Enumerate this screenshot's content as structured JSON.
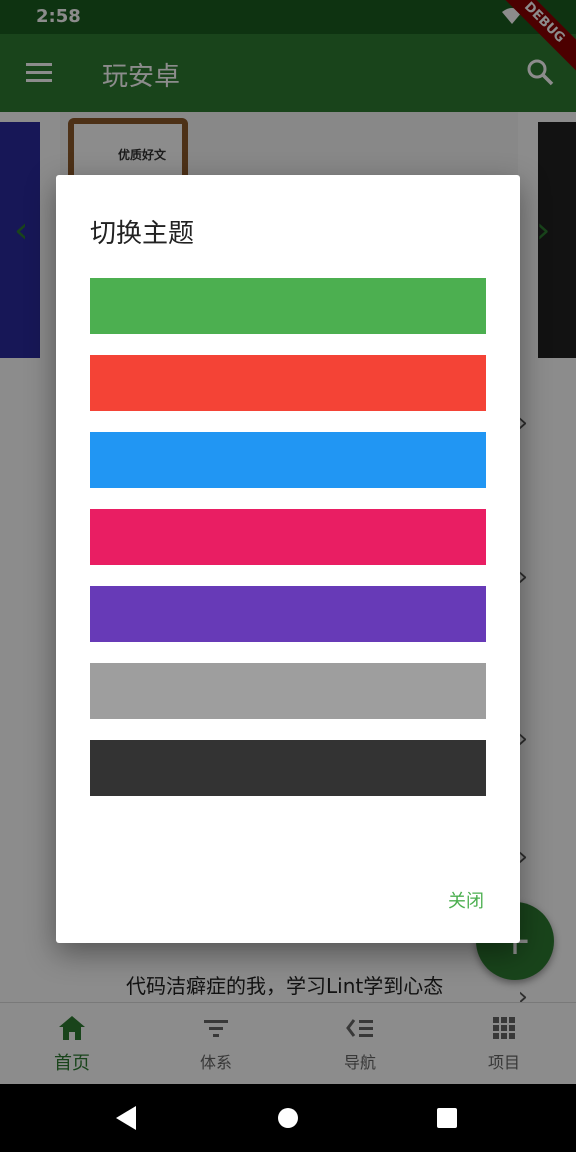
{
  "status_bar": {
    "time": "2:58",
    "debug_label": "DEBUG",
    "icons": [
      "wifi-icon",
      "battery-icon"
    ]
  },
  "app_bar": {
    "title": "玩安卓",
    "icons": [
      "menu-icon",
      "search-icon"
    ],
    "color": "#2e7d32"
  },
  "background_list": {
    "visible_item_text": "代码洁癖症的我，学习Lint学到心态",
    "banner_badge_text": "优质好文"
  },
  "bottom_nav": {
    "items": [
      {
        "label": "首页",
        "icon": "home-icon",
        "active": true
      },
      {
        "label": "体系",
        "icon": "filter-icon",
        "active": false
      },
      {
        "label": "导航",
        "icon": "navigation-icon",
        "active": false
      },
      {
        "label": "项目",
        "icon": "grid-icon",
        "active": false
      }
    ]
  },
  "dialog": {
    "title": "切换主题",
    "close_label": "关闭",
    "theme_colors": [
      "#4caf50",
      "#f44336",
      "#2196f3",
      "#e91e63",
      "#673ab7",
      "#9e9e9e",
      "#333333"
    ]
  }
}
